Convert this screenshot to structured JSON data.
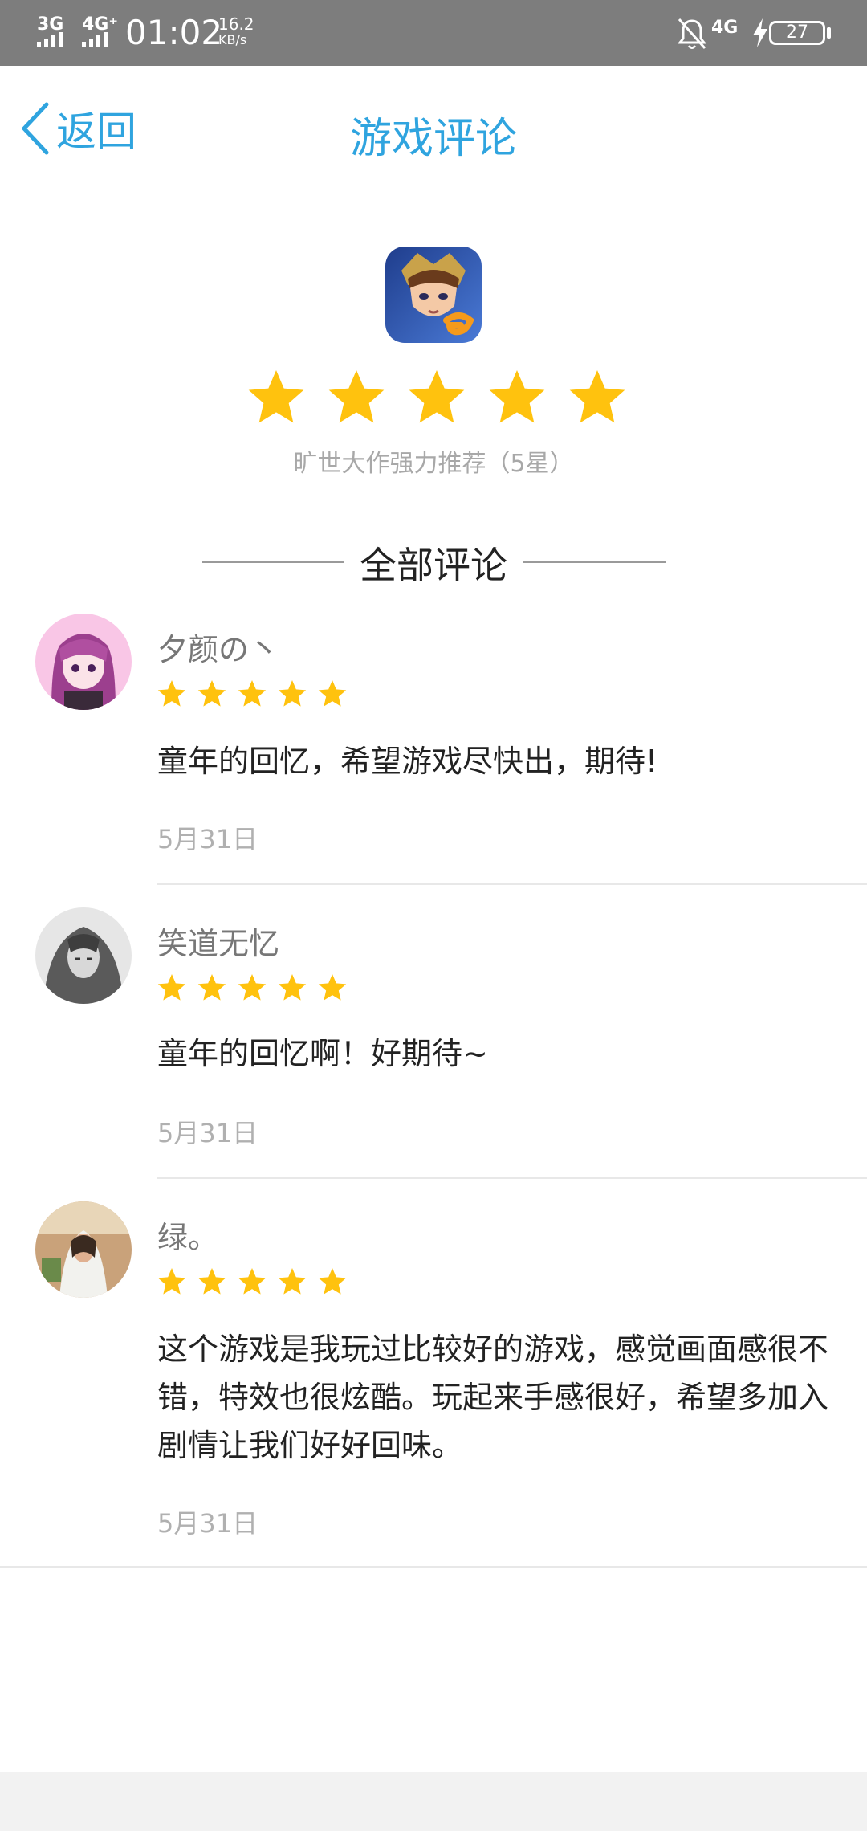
{
  "status_bar": {
    "net1": "3G",
    "net2": "4G⁺",
    "time": "01:02",
    "speed_value": "16.2",
    "speed_unit": "KB/s",
    "net3": "4G",
    "battery": "27"
  },
  "header": {
    "back_label": "返回",
    "title": "游戏评论"
  },
  "game": {
    "icon": "game-icon",
    "rating_stars": 5,
    "rating_text": "旷世大作强力推荐（5星）"
  },
  "section": {
    "title": "全部评论"
  },
  "reviews": [
    {
      "username": "夕颜の丶",
      "stars": 5,
      "text": "童年的回忆，希望游戏尽快出，期待!",
      "date": "5月31日"
    },
    {
      "username": "笑道无忆",
      "stars": 5,
      "text": "童年的回忆啊！好期待~",
      "date": "5月31日"
    },
    {
      "username": "绿。",
      "stars": 5,
      "text": "这个游戏是我玩过比较好的游戏，感觉画面感很不错，特效也很炫酷。玩起来手感很好，希望多加入剧情让我们好好回味。",
      "date": "5月31日"
    }
  ],
  "colors": {
    "accent": "#2fa4df",
    "star": "#ffc20e",
    "status_bar": "#7d7d7d"
  }
}
